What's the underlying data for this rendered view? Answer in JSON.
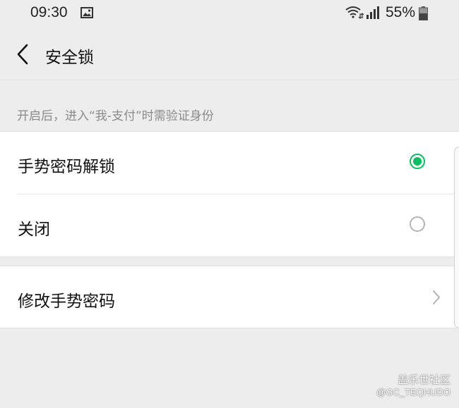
{
  "status_bar": {
    "time": "09:30",
    "battery": "55%",
    "icons": [
      "gallery-icon",
      "wifi-icon",
      "signal-icon",
      "battery-icon"
    ]
  },
  "header": {
    "title": "安全锁",
    "back_icon": "back-arrow-icon"
  },
  "description": "开启后，进入“我-支付”时需验证身份",
  "options": [
    {
      "label": "手势密码解锁",
      "selected": true
    },
    {
      "label": "关闭",
      "selected": false
    }
  ],
  "change_pattern": {
    "label": "修改手势密码",
    "icon": "chevron-right-icon"
  },
  "watermark": {
    "brand": "盖乐世社区",
    "handle": "@GC_TEQHUDO"
  },
  "colors": {
    "accent": "#07c160",
    "background": "#ededed",
    "card": "#ffffff",
    "muted_text": "#8a8a8a"
  }
}
